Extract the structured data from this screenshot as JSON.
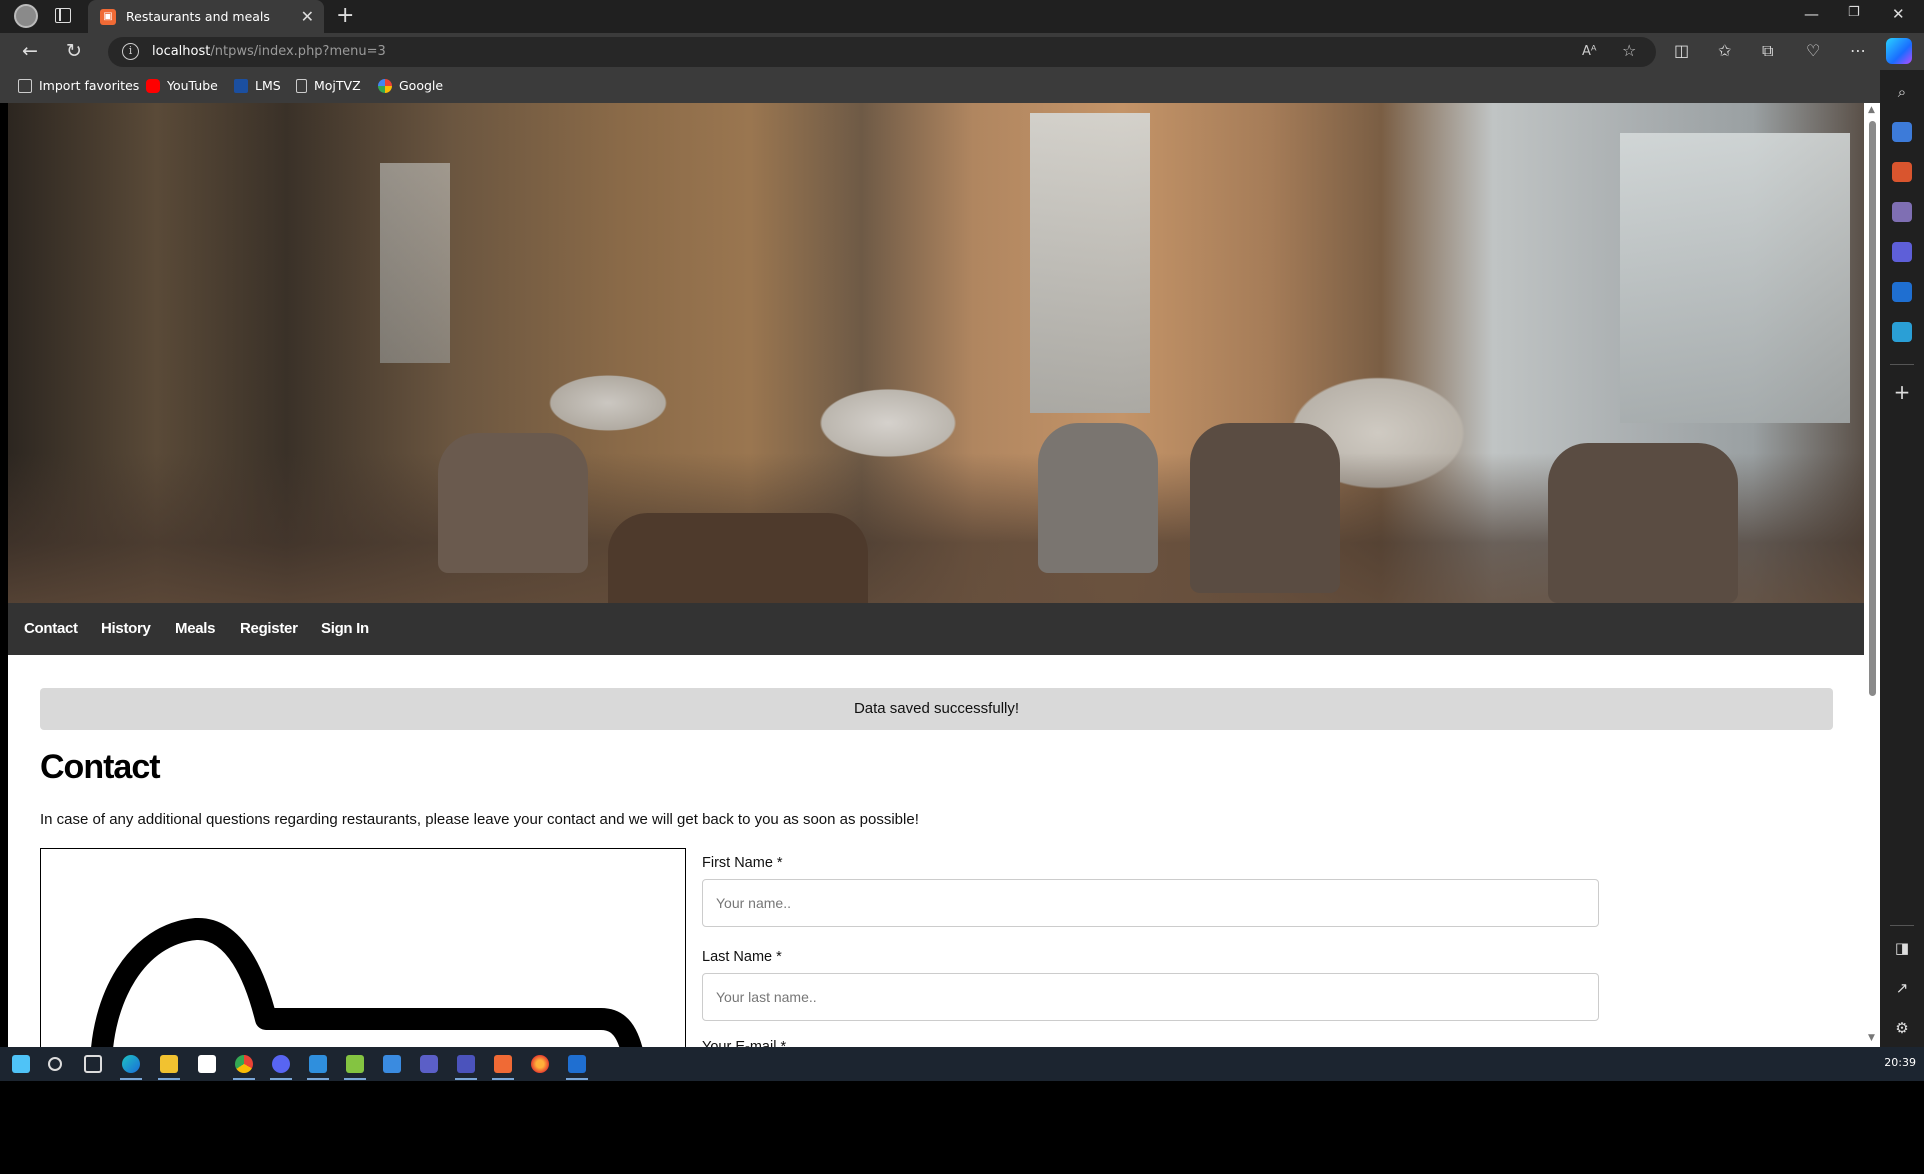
{
  "browser": {
    "tab_title": "Restaurants and meals",
    "url_host": "localhost",
    "url_path": "/ntpws/index.php?menu=3",
    "favorites": [
      {
        "label": "Import favorites",
        "icon": "import-icon"
      },
      {
        "label": "YouTube",
        "icon": "youtube-icon"
      },
      {
        "label": "LMS",
        "icon": "lms-icon"
      },
      {
        "label": "MojTVZ",
        "icon": "document-icon"
      },
      {
        "label": "Google",
        "icon": "google-icon"
      }
    ]
  },
  "site": {
    "nav": [
      "Contact",
      "History",
      "Meals",
      "Register",
      "Sign In"
    ],
    "alert": "Data saved successfully!",
    "page_title": "Contact",
    "intro": "In case of any additional questions regarding restaurants, please leave your contact and we will get back to you as soon as possible!",
    "form": {
      "first_name_label": "First Name *",
      "first_name_placeholder": "Your name..",
      "last_name_label": "Last Name *",
      "last_name_placeholder": "Your last name..",
      "email_label_partial": "Your E-mail *"
    }
  },
  "taskbar": {
    "clock": "20:39"
  },
  "colors": {
    "site_nav_bg": "#333333",
    "alert_bg": "#d9d9d9",
    "browser_chrome": "#3b3b3b"
  }
}
